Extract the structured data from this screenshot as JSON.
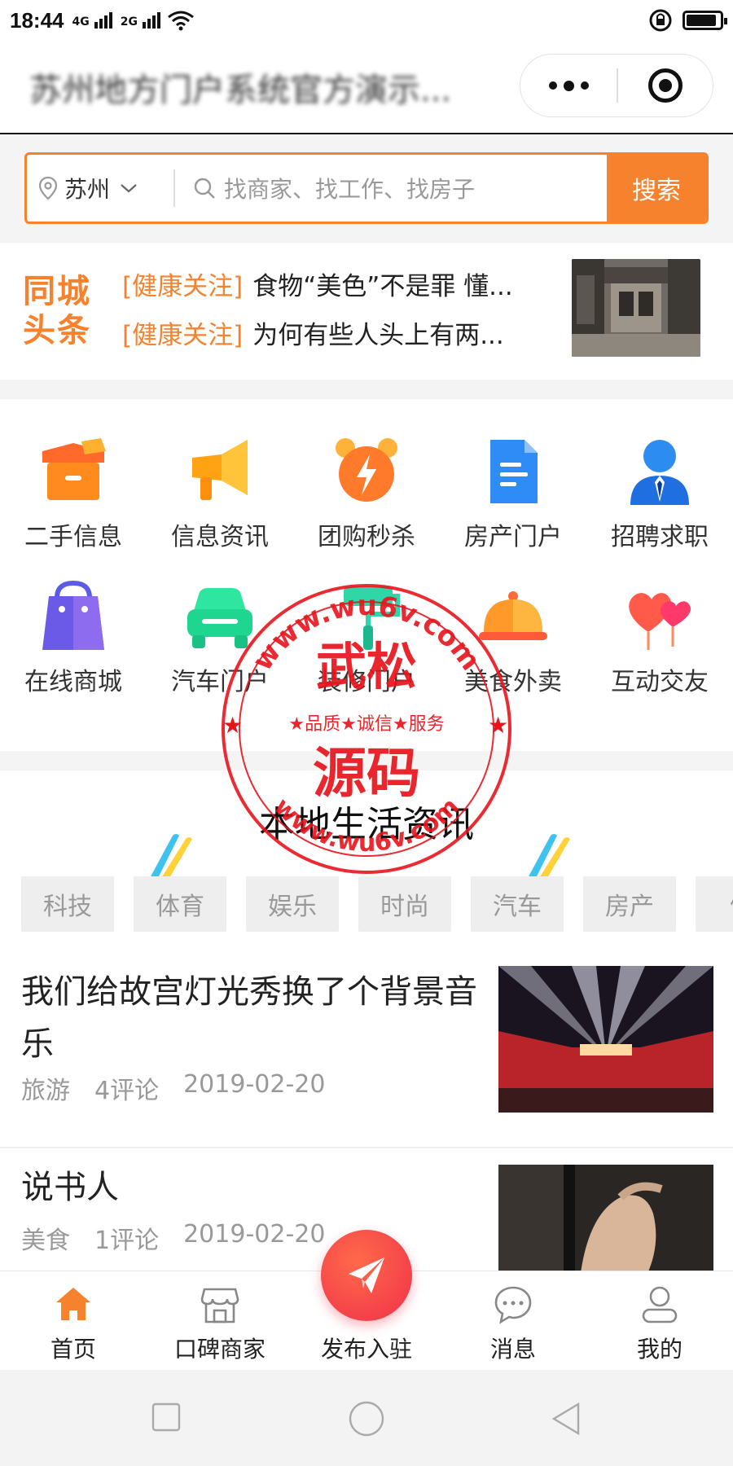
{
  "status": {
    "time": "18:44",
    "sig1": "4G",
    "sig2": "2G"
  },
  "app": {
    "title": "苏州地方门户系统官方演示..."
  },
  "search": {
    "city": "苏州",
    "placeholder": "找商家、找工作、找房子",
    "button": "搜索"
  },
  "headlines": {
    "logo_line1": "同城",
    "logo_line2": "头条",
    "items": [
      {
        "tag": "[健康关注]",
        "text": "食物“美色”不是罪 懂..."
      },
      {
        "tag": "[健康关注]",
        "text": "为何有些人头上有两..."
      }
    ]
  },
  "grid": {
    "items": [
      {
        "label": "二手信息",
        "icon": "box-icon"
      },
      {
        "label": "信息资讯",
        "icon": "megaphone-icon"
      },
      {
        "label": "团购秒杀",
        "icon": "alarm-clock-icon"
      },
      {
        "label": "房产门户",
        "icon": "document-icon"
      },
      {
        "label": "招聘求职",
        "icon": "person-tie-icon"
      },
      {
        "label": "在线商城",
        "icon": "shopping-bag-icon"
      },
      {
        "label": "汽车门户",
        "icon": "car-icon"
      },
      {
        "label": "装修门户",
        "icon": "paint-roller-icon"
      },
      {
        "label": "美食外卖",
        "icon": "food-cloche-icon"
      },
      {
        "label": "互动交友",
        "icon": "hearts-icon"
      }
    ]
  },
  "section": {
    "title": "本地生活资讯",
    "categories": [
      "科技",
      "体育",
      "娱乐",
      "时尚",
      "汽车",
      "房产",
      "健"
    ]
  },
  "news": [
    {
      "title": "我们给故宫灯光秀换了个背景音乐",
      "category": "旅游",
      "comments": "4评论",
      "date": "2019-02-20"
    },
    {
      "title": "说书人",
      "category": "美食",
      "comments": "1评论",
      "date": "2019-02-20"
    }
  ],
  "tabbar": {
    "items": [
      {
        "label": "首页",
        "icon": "home-icon"
      },
      {
        "label": "口碑商家",
        "icon": "store-icon"
      },
      {
        "label": "发布入驻",
        "icon": "paper-plane-icon"
      },
      {
        "label": "消息",
        "icon": "chat-bubble-icon"
      },
      {
        "label": "我的",
        "icon": "user-icon"
      }
    ]
  },
  "watermark": {
    "top_text": "www.wu6v.com",
    "bottom_text": "www.wu6v.com",
    "line1": "武松",
    "slogan": "★品质★诚信★服务",
    "line2": "源码"
  },
  "colors": {
    "accent": "#f6822e",
    "fab": "#f0304a",
    "muted": "#999999"
  }
}
